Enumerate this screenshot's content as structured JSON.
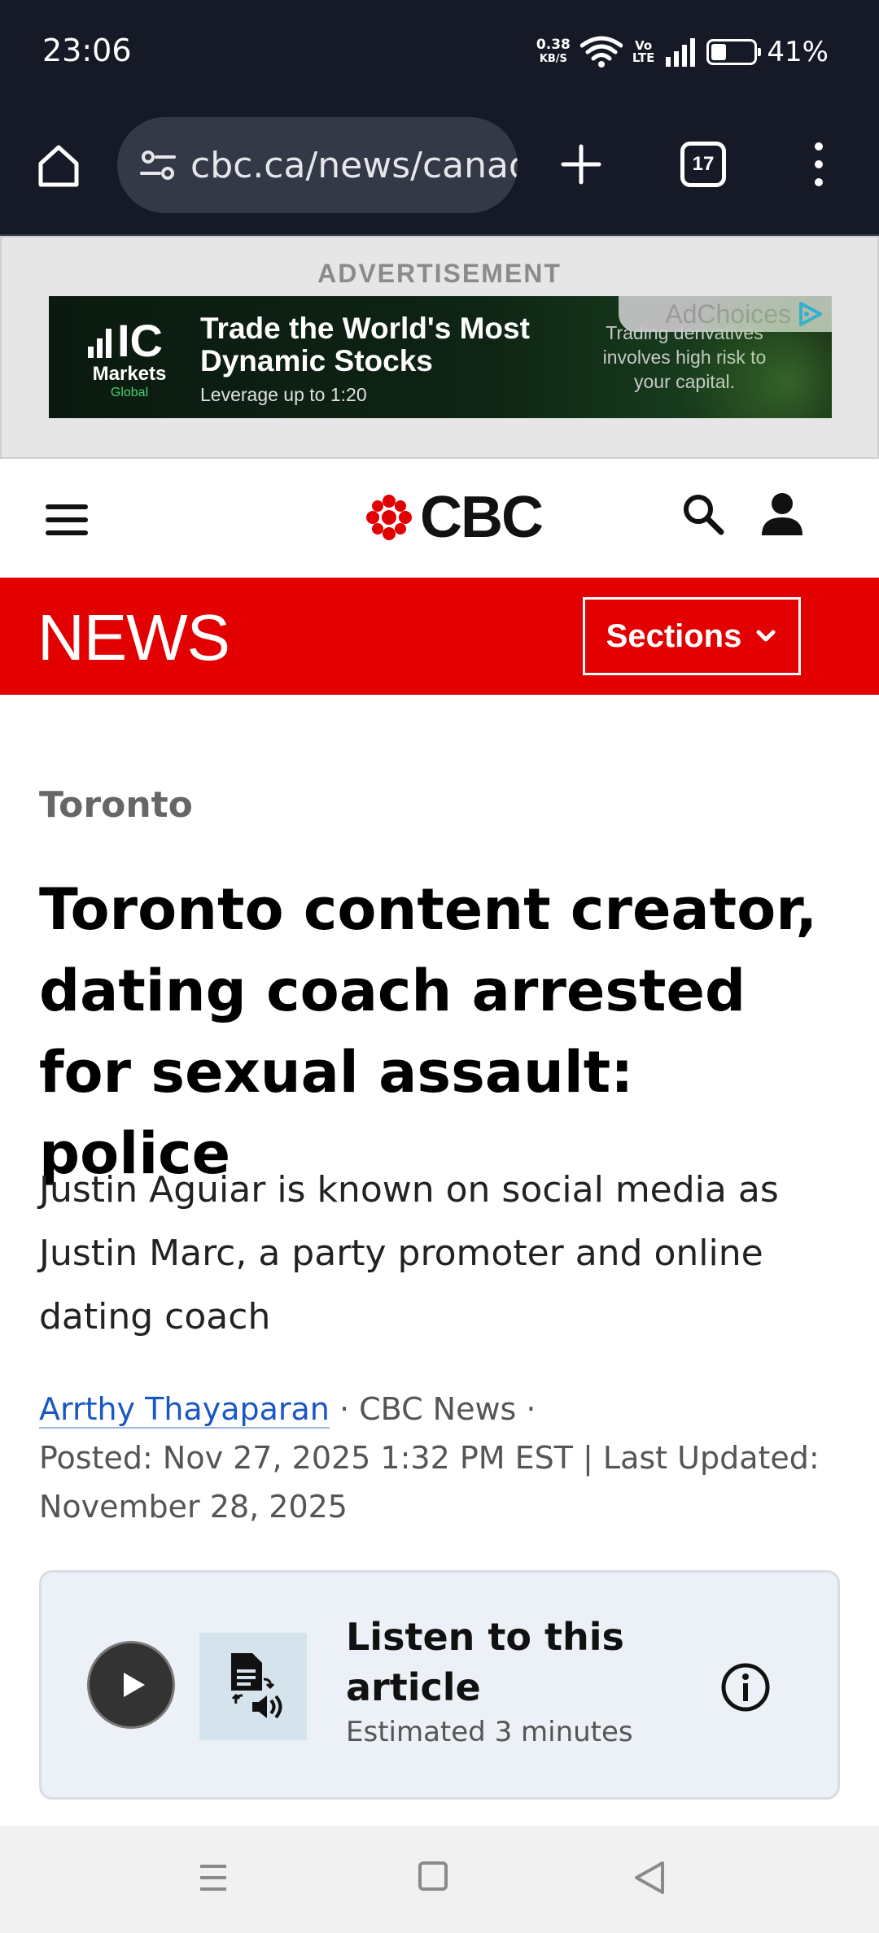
{
  "status_bar": {
    "time": "23:06",
    "net_speed_value": "0.38",
    "net_speed_unit": "KB/S",
    "volte_top": "Vo",
    "volte_bottom": "LTE",
    "battery_percent": "41%"
  },
  "browser": {
    "url": "cbc.ca/news/canada/toronto",
    "tab_count": "17"
  },
  "ad": {
    "label": "ADVERTISEMENT",
    "brand_ic": "IC",
    "brand_markets": "Markets",
    "brand_global": "Global",
    "headline_line1": "Trade the World's Most",
    "headline_line2": "Dynamic Stocks",
    "subline": "Leverage up to 1:20",
    "risk_text": "Trading derivatives involves high risk to your capital.",
    "adchoices": "AdChoices",
    "accent_color": "#48d36d"
  },
  "header": {
    "logo_text": "CBC",
    "news_label": "NEWS",
    "sections_label": "Sections",
    "brand_red": "#e20000"
  },
  "article": {
    "category": "Toronto",
    "headline": "Toronto content creator, dating coach arrested for sexual assault: police",
    "deck": "Justin Aguiar is known on social media as Justin Marc, a party promoter and online dating coach",
    "author": "Arrthy Thayaparan",
    "source": " · CBC News ·",
    "posted": "Posted: Nov 27, 2025 1:32 PM EST | Last Updated: November 28, 2025"
  },
  "listen": {
    "title": "Listen to this article",
    "estimate": "Estimated 3 minutes"
  }
}
